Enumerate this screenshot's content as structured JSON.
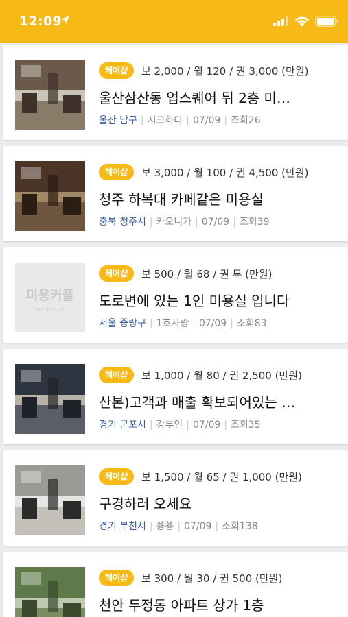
{
  "status_bar": {
    "time": "12:09",
    "icons": [
      "location-arrow-icon",
      "signal-icon",
      "wifi-icon",
      "battery-icon"
    ]
  },
  "colors": {
    "accent": "#f7b916",
    "region": "#3b5fa8"
  },
  "listings": [
    {
      "badge": "헤어샵",
      "price": "보 2,000 / 월 120 / 권 3,000 (만원)",
      "title": "울산삼산동 업스퀘어 뒤 2층 미…",
      "region": "울산 남구",
      "author": "시크하다",
      "date": "07/09",
      "views": "조회26",
      "thumb": "salon-photo"
    },
    {
      "badge": "헤어샵",
      "price": "보 3,000 / 월 100 / 권 4,500 (만원)",
      "title": "청주 하복대 카페같은 미용실",
      "region": "충북 청주시",
      "author": "카오니가",
      "date": "07/09",
      "views": "조회39",
      "thumb": "salon-photo"
    },
    {
      "badge": "헤어샵",
      "price": "보 500 / 월 68 / 권 무 (만원)",
      "title": "도로변에 있는 1인 미용실 입니다",
      "region": "서울 중랑구",
      "author": "1호사랑",
      "date": "07/09",
      "views": "조회83",
      "thumb": "placeholder",
      "placeholder_title": "미용커플",
      "placeholder_sub": "no image"
    },
    {
      "badge": "헤어샵",
      "price": "보 1,000 / 월 80 / 권 2,500 (만원)",
      "title": "산본)고객과 매출 확보되어있는 …",
      "region": "경기 군포시",
      "author": "강부인",
      "date": "07/09",
      "views": "조회35",
      "thumb": "salon-photo"
    },
    {
      "badge": "헤어샵",
      "price": "보 1,500 / 월 65 / 권 1,000 (만원)",
      "title": "구경하러 오세요",
      "region": "경기 부천시",
      "author": "쑝쑝",
      "date": "07/09",
      "views": "조회138",
      "thumb": "salon-photo"
    },
    {
      "badge": "헤어샵",
      "price": "보 300 / 월 30 / 권 500 (만원)",
      "title": "천안 두정동 아파트 상가 1층",
      "region": "",
      "author": "",
      "date": "",
      "views": "",
      "thumb": "street-photo"
    }
  ]
}
